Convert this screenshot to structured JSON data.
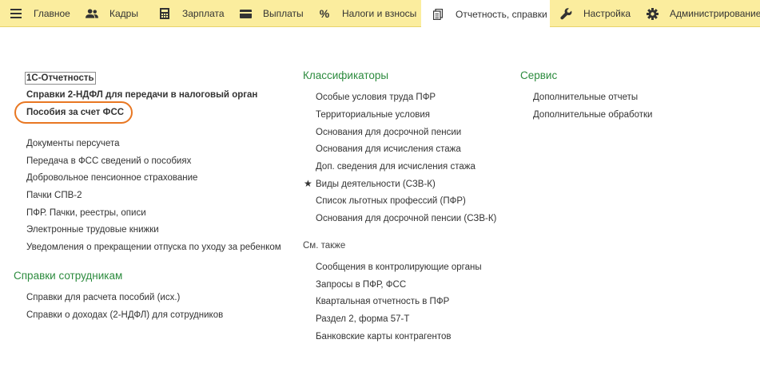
{
  "nav": {
    "tabs": [
      {
        "label": "Главное",
        "icon": "hamburger-menu-icon"
      },
      {
        "label": "Кадры",
        "icon": "users-icon"
      },
      {
        "label": "Зарплата",
        "icon": "calculator-icon"
      },
      {
        "label": "Выплаты",
        "icon": "wallet-icon"
      },
      {
        "label": "Налоги и взносы",
        "icon": "percent-icon"
      },
      {
        "label": "Отчетность, справки",
        "icon": "documents-icon",
        "active": true
      },
      {
        "label": "Настройка",
        "icon": "wrench-icon"
      },
      {
        "label": "Администрирование",
        "icon": "gear-icon"
      }
    ]
  },
  "left_column": {
    "top_links": [
      "1С-Отчетность",
      "Справки 2-НДФЛ для передачи в налоговый орган",
      "Пособия за счет ФСС"
    ],
    "links": [
      "Документы персучета",
      "Передача в ФСС сведений о пособиях",
      "Добровольное пенсионное страхование",
      "Пачки СПВ-2",
      "ПФР. Пачки, реестры, описи",
      "Электронные трудовые книжки",
      "Уведомления о прекращении отпуска по уходу за ребенком"
    ],
    "section_header": "Справки сотрудникам",
    "section_links": [
      "Справки для расчета пособий (исх.)",
      "Справки о доходах (2-НДФЛ) для сотрудников"
    ]
  },
  "middle_column": {
    "header": "Классификаторы",
    "links": [
      "Особые условия труда ПФР",
      "Территориальные условия",
      "Основания для досрочной пенсии",
      "Основания для исчисления стажа",
      "Доп. сведения для исчисления стажа",
      "Виды деятельности (СЗВ-К)",
      "Список льготных профессий (ПФР)",
      "Основания для досрочной пенсии (СЗВ-К)"
    ],
    "starred_index": 5,
    "see_also_label": "См. также",
    "see_also_links": [
      "Сообщения в контролирующие органы",
      "Запросы в ПФР, ФСС",
      "Квартальная отчетность в ПФР",
      "Раздел 2, форма 57-Т",
      "Банковские карты контрагентов"
    ]
  },
  "right_column": {
    "header": "Сервис",
    "links": [
      "Дополнительные отчеты",
      "Дополнительные обработки"
    ]
  },
  "colors": {
    "topbar": "#fbed9e",
    "header_green": "#2c8b3e",
    "highlight_ring": "#e87722"
  }
}
